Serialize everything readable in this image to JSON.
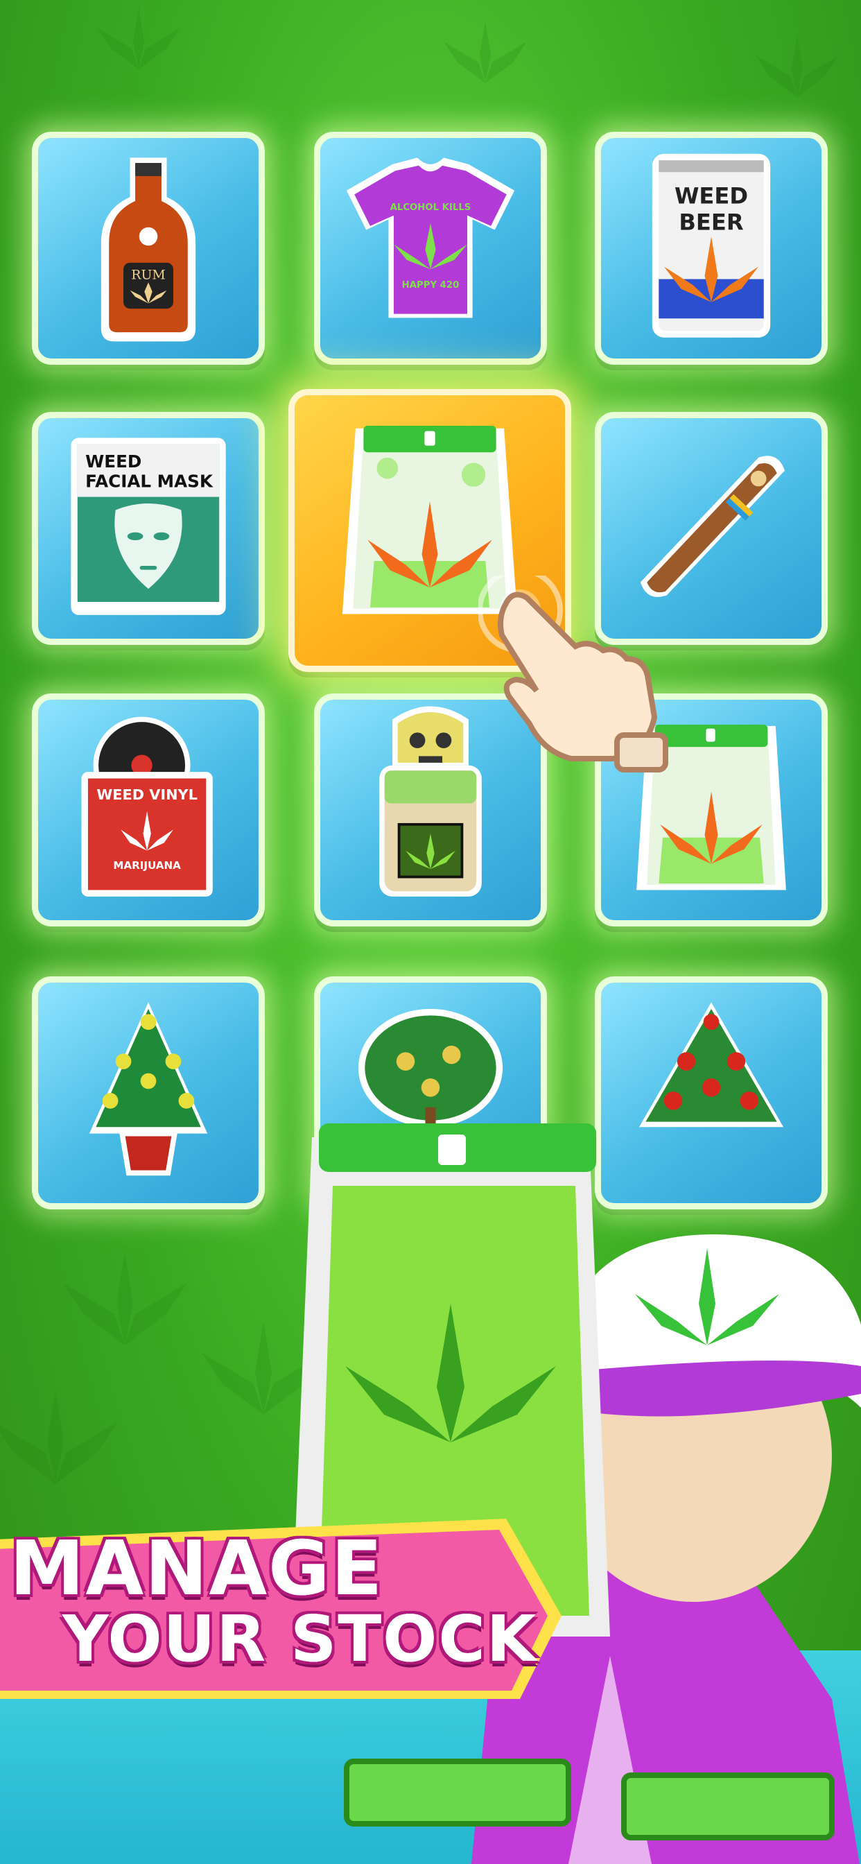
{
  "banner": {
    "line1": "MANAGE",
    "line2": "YOUR STOCK"
  },
  "tiles": [
    {
      "name": "rum-bottle",
      "label": "RUM"
    },
    {
      "name": "t-shirt",
      "label_top": "ALCOHOL KILLS",
      "label_bottom": "HAPPY 420"
    },
    {
      "name": "beer-can",
      "label_1": "WEED",
      "label_2": "BEER"
    },
    {
      "name": "facial-mask",
      "label_1": "WEED",
      "label_2": "FACIAL MASK"
    },
    {
      "name": "weed-bag-selected"
    },
    {
      "name": "cigar"
    },
    {
      "name": "vinyl-record",
      "label": "WEED VINYL",
      "sublabel": "MARIJUANA"
    },
    {
      "name": "skull-jar"
    },
    {
      "name": "weed-bag"
    },
    {
      "name": "plant-yellow"
    },
    {
      "name": "plant-bonsai"
    },
    {
      "name": "plant-red"
    }
  ],
  "colors": {
    "bg_green": "#3aaa22",
    "tile_blue": "#48bbe6",
    "tile_selected": "#ffb41e",
    "banner_pink": "#f25aa6"
  }
}
